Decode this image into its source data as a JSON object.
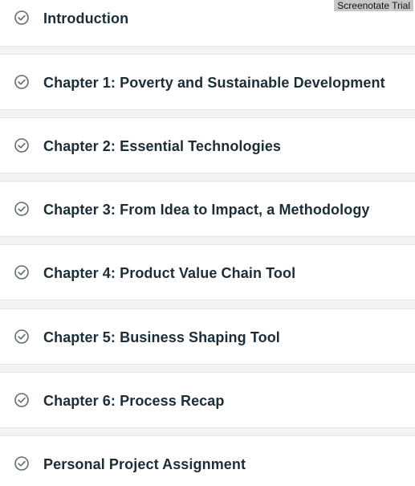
{
  "watermark": "Screenotate Trial",
  "chapters": [
    {
      "title": "Introduction",
      "icon": "check-circle-icon",
      "completed": true
    },
    {
      "title": "Chapter 1: Poverty and Sustainable Development",
      "icon": "check-circle-icon",
      "completed": true
    },
    {
      "title": "Chapter 2: Essential Technologies",
      "icon": "check-circle-icon",
      "completed": true
    },
    {
      "title": "Chapter 3: From Idea to Impact, a Methodology",
      "icon": "check-circle-icon",
      "completed": true
    },
    {
      "title": "Chapter 4: Product Value Chain Tool",
      "icon": "check-circle-icon",
      "completed": true
    },
    {
      "title": "Chapter 5: Business Shaping Tool",
      "icon": "check-circle-icon",
      "completed": true
    },
    {
      "title": "Chapter 6: Process Recap",
      "icon": "check-circle-icon",
      "completed": true
    },
    {
      "title": "Personal Project Assignment",
      "icon": "check-circle-icon",
      "completed": true
    }
  ],
  "colors": {
    "title": "#1c2d3a",
    "icon": "#5f6b73",
    "background": "#f1f3f4",
    "card": "#ffffff"
  }
}
